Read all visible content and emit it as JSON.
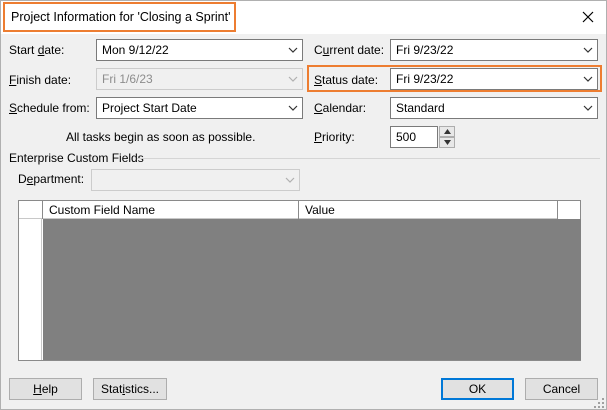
{
  "title": "Project Information for 'Closing a Sprint'",
  "fields": {
    "start_date": {
      "label_pre": "Start ",
      "label_key": "d",
      "label_post": "ate:",
      "value": "Mon 9/12/22"
    },
    "finish_date": {
      "label_pre": "",
      "label_key": "F",
      "label_post": "inish date:",
      "value": "Fri 1/6/23"
    },
    "schedule_from": {
      "label_pre": "",
      "label_key": "S",
      "label_post": "chedule from:",
      "value": "Project Start Date"
    },
    "schedule_note": "All tasks begin as soon as possible.",
    "current_date": {
      "label_pre": "C",
      "label_key": "u",
      "label_post": "rrent date:",
      "value": "Fri 9/23/22"
    },
    "status_date": {
      "label_pre": "",
      "label_key": "S",
      "label_post": "tatus date:",
      "value": "Fri 9/23/22"
    },
    "calendar": {
      "label_pre": "",
      "label_key": "C",
      "label_post": "alendar:",
      "value": "Standard"
    },
    "priority": {
      "label_pre": "",
      "label_key": "P",
      "label_post": "riority:",
      "value": "500"
    }
  },
  "enterprise": {
    "group_label": "Enterprise Custom Fields",
    "department_pre": "D",
    "department_key": "e",
    "department_post": "partment:",
    "department_value": "",
    "columns": [
      "Custom Field Name",
      "Value"
    ]
  },
  "buttons": {
    "help_key": "H",
    "help_post": "elp",
    "statistics_pre": "Stat",
    "statistics_key": "i",
    "statistics_post": "stics...",
    "ok": "OK",
    "cancel": "Cancel"
  },
  "colors": {
    "highlight": "#ed7d31",
    "grid_fill": "#808080",
    "dialog_bg": "#f0f0f0"
  },
  "icons": [
    "close-icon",
    "chevron-down-icon",
    "spin-up-icon",
    "spin-down-icon",
    "resize-grip-icon"
  ]
}
